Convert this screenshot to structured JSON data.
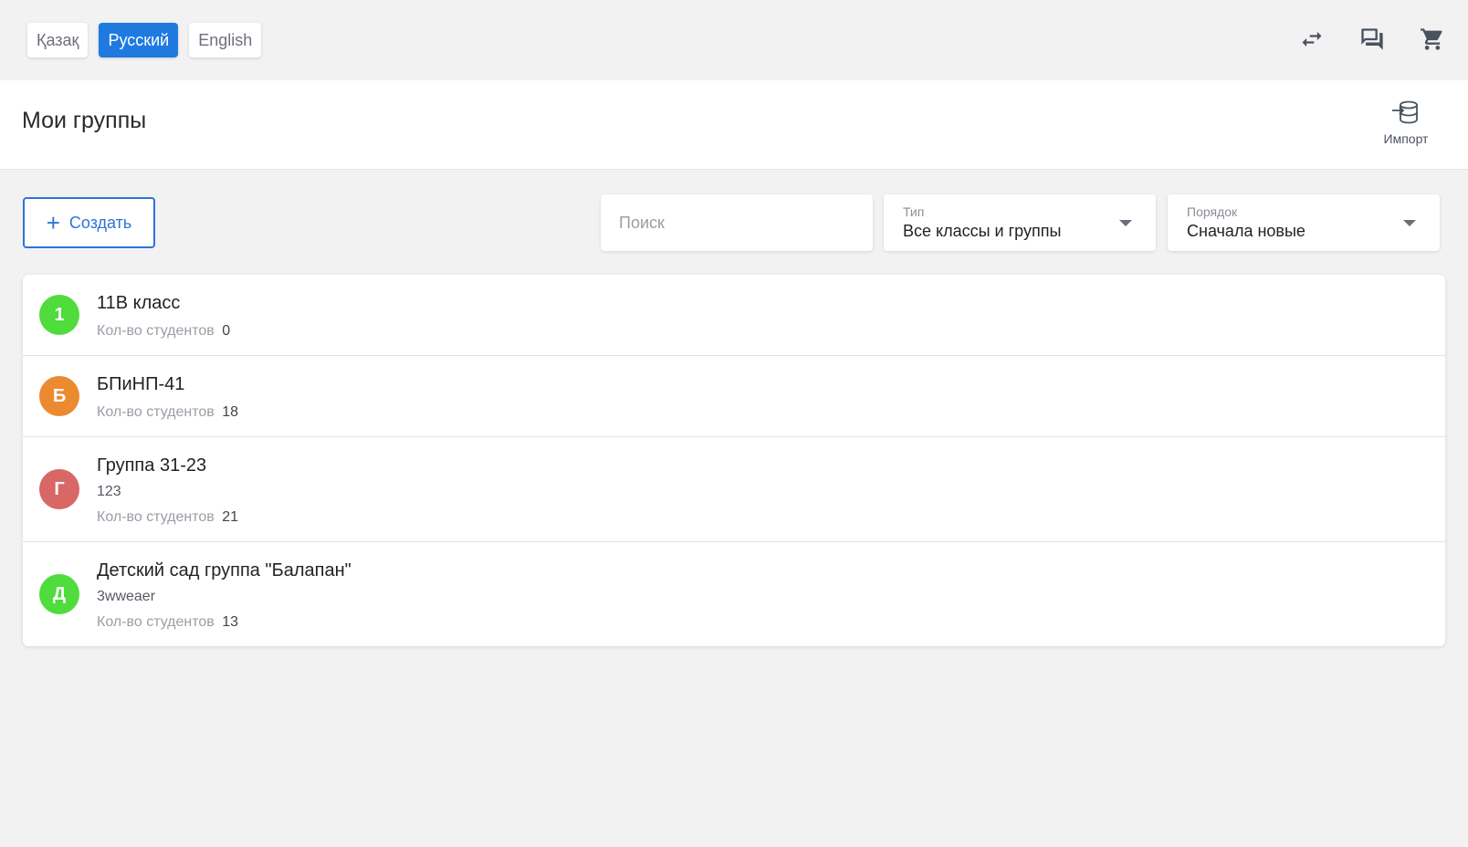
{
  "languages": [
    {
      "label": "Қазақ",
      "active": false
    },
    {
      "label": "Русский",
      "active": true
    },
    {
      "label": "English",
      "active": false
    }
  ],
  "top_icons": [
    "swap-icon",
    "chat-icon",
    "cart-icon"
  ],
  "header": {
    "title": "Мои группы",
    "import_label": "Импорт"
  },
  "toolbar": {
    "create_label": "Создать",
    "search_placeholder": "Поиск",
    "type_label": "Тип",
    "type_value": "Все классы и группы",
    "order_label": "Порядок",
    "order_value": "Сначала новые"
  },
  "groups": [
    {
      "initial": "1",
      "name": "11B класс",
      "description": "",
      "count_label": "Кол-во студентов",
      "count": "0",
      "color": "#4fdc3c"
    },
    {
      "initial": "Б",
      "name": "БПиНП-41",
      "description": "",
      "count_label": "Кол-во студентов",
      "count": "18",
      "color": "#ec8a2f"
    },
    {
      "initial": "Г",
      "name": "Группа 31-23",
      "description": "123",
      "count_label": "Кол-во студентов",
      "count": "21",
      "color": "#d86766"
    },
    {
      "initial": "Д",
      "name": "Детский сад группа \"Балапан\"",
      "description": "3wweaer",
      "count_label": "Кол-во студентов",
      "count": "13",
      "color": "#4fdc3c"
    }
  ],
  "colors": {
    "accent": "#1f7ae0",
    "background": "#f2f2f2"
  }
}
